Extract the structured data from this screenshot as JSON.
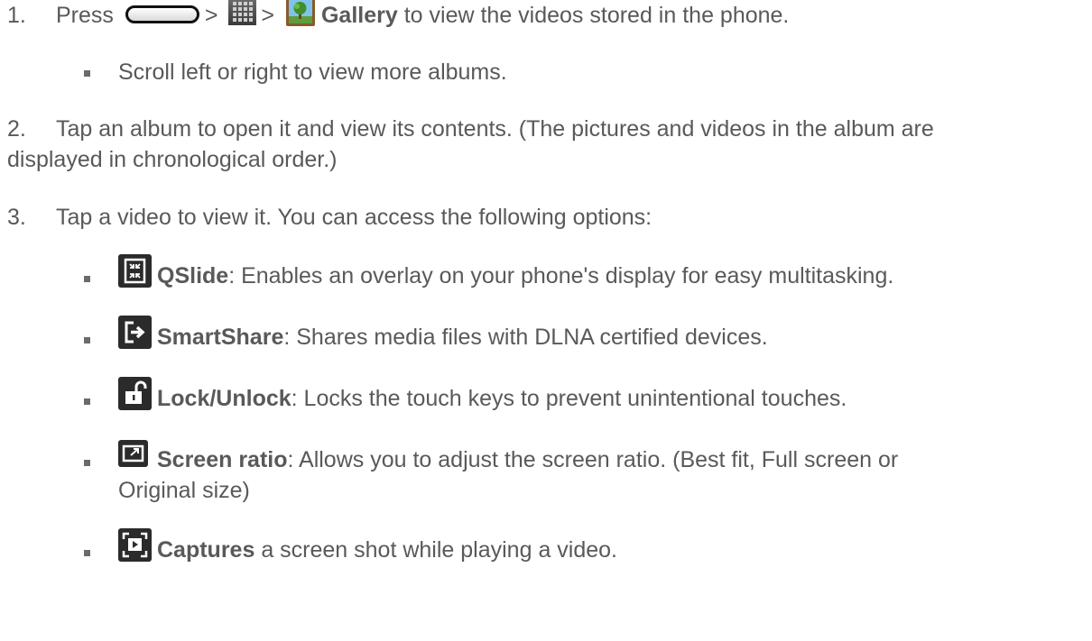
{
  "steps": [
    {
      "number": "1.",
      "press": "Press",
      "sep1": ">",
      "sep2": ">",
      "gallery_label": "Gallery",
      "rest": "to view the videos stored in the phone.",
      "sub": "Scroll left or right to view more albums."
    },
    {
      "number": "2.",
      "line1": "Tap an album to open it and view its contents. (The pictures and videos in the album are",
      "line2": "displayed in chronological order.)"
    },
    {
      "number": "3.",
      "line1": "Tap a video to view it. You can access the following options:"
    }
  ],
  "options": [
    {
      "icon": "qslide-icon",
      "label": "QSlide",
      "desc": ": Enables an overlay on your phone's display for easy multitasking."
    },
    {
      "icon": "smartshare-icon",
      "label": "SmartShare",
      "desc": ": Shares media files with DLNA certified devices."
    },
    {
      "icon": "lock-icon",
      "label": "Lock/Unlock",
      "desc": ": Locks the touch keys to prevent unintentional touches."
    },
    {
      "icon": "screen-ratio-icon",
      "label": "Screen ratio",
      "desc": ": Allows you to adjust the screen ratio. (Best fit, Full screen or",
      "desc2": "Original size)"
    },
    {
      "icon": "capture-icon",
      "label": "Captures",
      "desc": " a screen shot while playing a video."
    }
  ],
  "colors": {
    "text": "#595959",
    "bold": "#595959",
    "icon_bg": "#2b2b2b"
  }
}
